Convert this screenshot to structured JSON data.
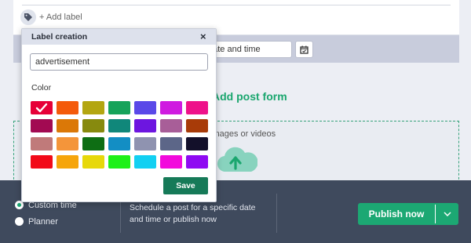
{
  "top": {
    "add_label": "+ Add label",
    "icon": "tag-icon"
  },
  "schedule": {
    "date_value": "date and time",
    "calendar_icon": "calendar-icon"
  },
  "form": {
    "title": "Add post form"
  },
  "dropzone": {
    "text": "images or videos",
    "icon": "cloud-upload-icon"
  },
  "bottom": {
    "options": [
      {
        "label": "Custom time",
        "selected": true
      },
      {
        "label": "Planner",
        "selected": false
      }
    ],
    "description": "Schedule a post for a specific date and time or publish now",
    "publish_label": "Publish now",
    "accent": "#1ca873"
  },
  "modal": {
    "title": "Label creation",
    "close": "×",
    "input_value": "advertisement",
    "color_title": "Color",
    "save_label": "Save",
    "selected_color": 0,
    "colors": [
      "#e60038",
      "#f45a0a",
      "#b3a611",
      "#16a35a",
      "#5a49e8",
      "#cf1be0",
      "#ee128a",
      "#a20a52",
      "#db7807",
      "#878a0e",
      "#10877a",
      "#6d16e0",
      "#a85e98",
      "#a83b08",
      "#c07a7a",
      "#f4953a",
      "#0e6e14",
      "#138ec4",
      "#8f93b0",
      "#5c6688",
      "#13102a",
      "#f20a19",
      "#f6a50b",
      "#e7d80a",
      "#1ef018",
      "#12d0f2",
      "#f20adc",
      "#8f0af2"
    ]
  }
}
